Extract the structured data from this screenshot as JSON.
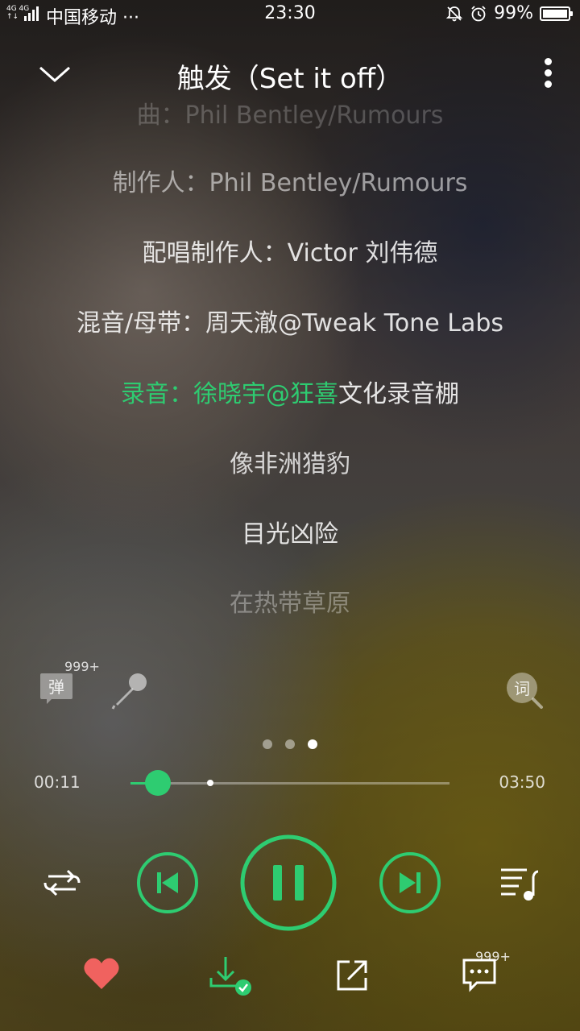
{
  "status_bar": {
    "network": "4G 4G",
    "carrier": "中国移动 ···",
    "time": "23:30",
    "battery": "99%"
  },
  "header": {
    "title": "触发（Set it off）"
  },
  "lyrics": {
    "lines": [
      "曲：Phil Bentley/Rumours",
      "制作人：Phil Bentley/Rumours",
      "配唱制作人：Victor 刘伟德",
      "混音/母带：周天澈@Tweak Tone Labs",
      "像非洲猎豹",
      "目光凶险",
      "在热带草原"
    ],
    "current": {
      "played": "录音：徐晓宇@狂喜",
      "remaining": "文化录音棚"
    }
  },
  "tools": {
    "danmu_label": "弹",
    "danmu_count": "999+",
    "lyric_search_label": "词"
  },
  "progress": {
    "current_time": "00:11",
    "total_time": "03:50",
    "played_fraction": 0.085,
    "buffered_fraction": 0.25
  },
  "pager": {
    "count": 3,
    "active": 2
  },
  "actions": {
    "comment_count": "999+"
  },
  "colors": {
    "accent": "#2ecc71",
    "like": "#f0625f"
  }
}
